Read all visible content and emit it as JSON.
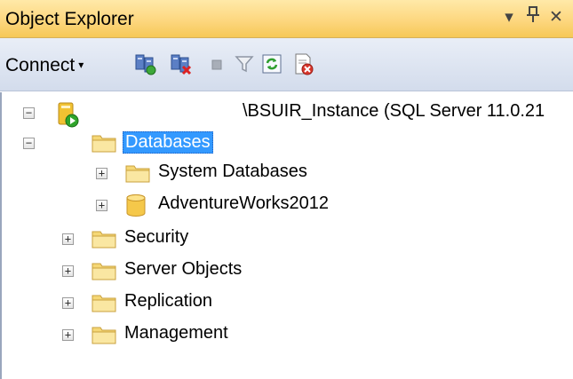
{
  "panel": {
    "title": "Object Explorer",
    "dropdown_glyph": "▾",
    "pin_glyph": "ᚹ",
    "close_glyph": "✕"
  },
  "toolbar": {
    "connect_label": "Connect",
    "connect_caret": "▾",
    "icons": [
      "connect-server-icon",
      "disconnect-server-icon",
      "stop-icon",
      "filter-icon",
      "refresh-icon",
      "delete-icon"
    ]
  },
  "tree": {
    "expand_glyph": "+",
    "collapse_glyph": "−",
    "server": {
      "label": "\\BSUIR_Instance (SQL Server 11.0.21",
      "expanded": true
    },
    "databases": {
      "label": "Databases",
      "expanded": true,
      "selected": true
    },
    "db_children": [
      {
        "label": "System Databases",
        "icon": "folder-icon"
      },
      {
        "label": "AdventureWorks2012",
        "icon": "database-icon"
      }
    ],
    "server_children": [
      {
        "label": "Security"
      },
      {
        "label": "Server Objects"
      },
      {
        "label": "Replication"
      },
      {
        "label": "Management"
      }
    ]
  },
  "colors": {
    "title_bg": "#fdd77f",
    "toolbar_bg": "#d3dcec",
    "selection": "#3399ff",
    "folder": "#f5d775"
  }
}
